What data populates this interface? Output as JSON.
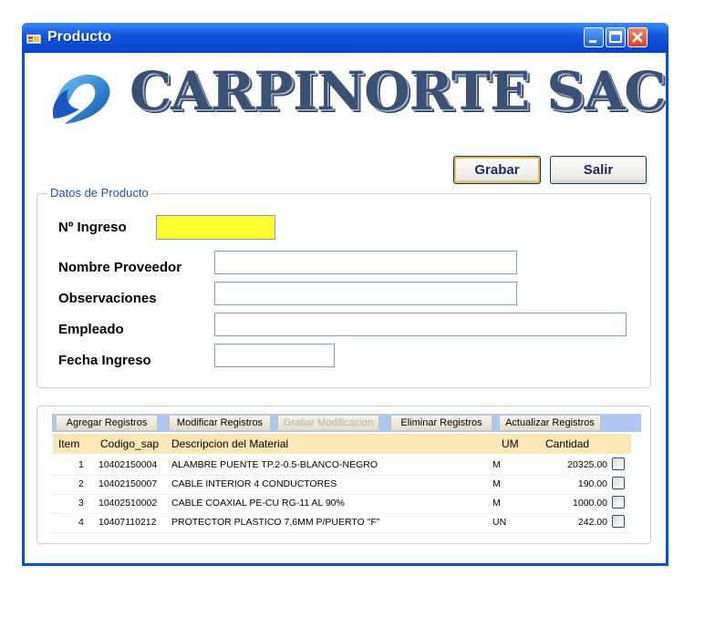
{
  "window": {
    "title": "Producto"
  },
  "brand": {
    "name": "CARPINORTE SAC"
  },
  "buttons": {
    "save": "Grabar",
    "exit": "Salir"
  },
  "product_group": {
    "legend": "Datos de Producto",
    "ingreso_label": "Nº Ingreso",
    "ingreso_value": "",
    "proveedor_label": "Nombre Proveedor",
    "proveedor_value": "",
    "observaciones_label": "Observaciones",
    "observaciones_value": "",
    "empleado_label": "Empleado",
    "empleado_value": "",
    "fecha_label": "Fecha Ingreso",
    "fecha_value": ""
  },
  "toolbar": {
    "add": "Agregar Registros",
    "modify": "Modificar Registros",
    "save_mod": "Grabar Modificacion",
    "delete": "Eliminar Registros",
    "refresh": "Actualizar Registros"
  },
  "grid": {
    "headers": [
      "Item",
      "Codigo_sap",
      "Descripcion del Material",
      "UM",
      "Cantidad"
    ],
    "rows": [
      {
        "item": "1",
        "code": "10402150004",
        "desc": "ALAMBRE PUENTE TP.2-0.5-BLANCO-NEGRO",
        "um": "M",
        "qty": "20325.00",
        "checked": false
      },
      {
        "item": "2",
        "code": "10402150007",
        "desc": "CABLE INTERIOR 4 CONDUCTORES",
        "um": "M",
        "qty": "190.00",
        "checked": false
      },
      {
        "item": "3",
        "code": "10402510002",
        "desc": "CABLE COAXIAL PE-CU RG-11 AL 90%",
        "um": "M",
        "qty": "1000.00",
        "checked": false
      },
      {
        "item": "4",
        "code": "10407110212",
        "desc": "PROTECTOR PLASTICO 7,6MM P/PUERTO \"F\"",
        "um": "UN",
        "qty": "242.00",
        "checked": false
      }
    ]
  },
  "colors": {
    "titlebar": "#0a45cf",
    "ingreso_field": "#ffff33",
    "grid_header": "#fde7b6",
    "toolbar": "#aec6f0"
  }
}
